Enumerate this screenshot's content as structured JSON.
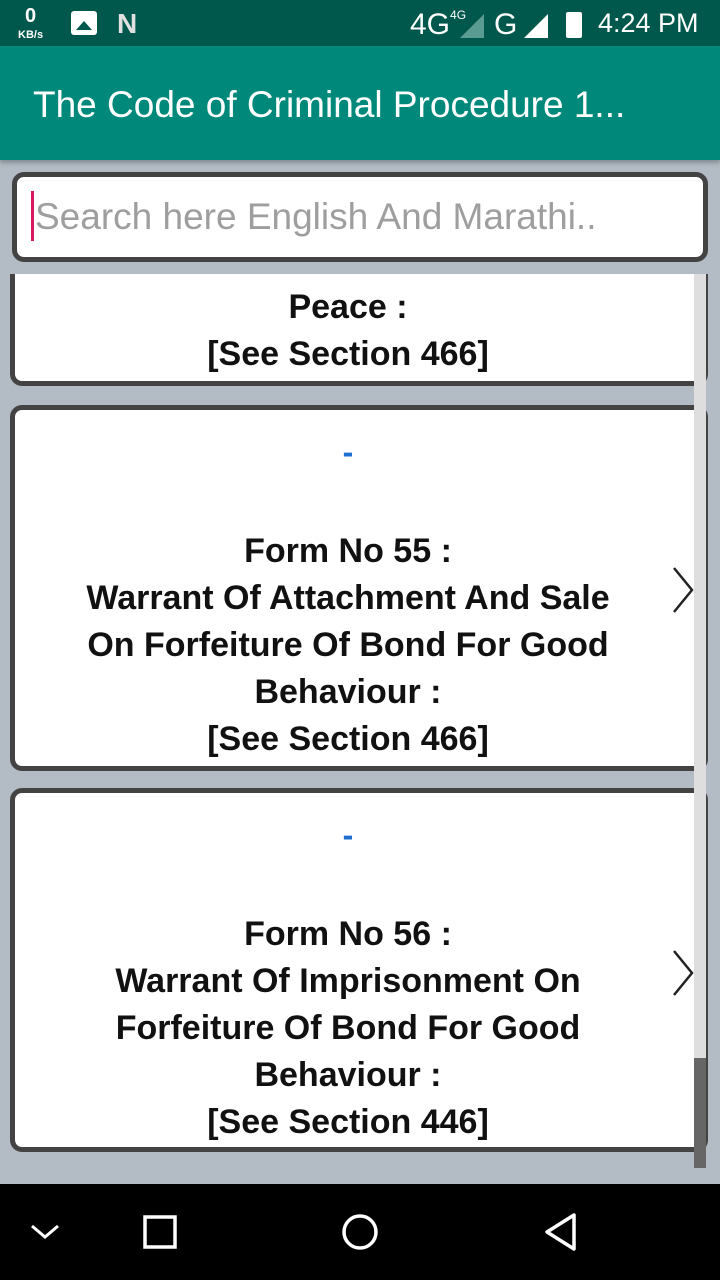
{
  "status_bar": {
    "net_speed": "0",
    "net_unit": "KB/s",
    "network1": "4G",
    "network1_sup": "4G",
    "network2": "G",
    "time": "4:24 PM",
    "icons": [
      "image-icon",
      "n-icon",
      "signal-icon",
      "battery-charging-icon"
    ]
  },
  "app_bar": {
    "title": "The Code of Criminal Procedure 1..."
  },
  "search": {
    "placeholder": "Search here English And Marathi..",
    "value": ""
  },
  "list": {
    "items": [
      {
        "dash": "",
        "lines": [
          "Peace :",
          "[See Section 466]"
        ]
      },
      {
        "dash": "-",
        "lines": [
          "Form No 55 :",
          "Warrant Of Attachment And Sale",
          "On Forfeiture Of Bond For Good",
          "Behaviour :",
          "[See Section 466]"
        ]
      },
      {
        "dash": "-",
        "lines": [
          "Form No 56 :",
          "Warrant Of Imprisonment On",
          "Forfeiture Of Bond For Good",
          "Behaviour :",
          "[See Section 446]"
        ]
      }
    ]
  },
  "colors": {
    "status_bar": "#00574b",
    "app_bar": "#00897b",
    "dash": "#1e6fd0",
    "background": "#b3bbc4"
  },
  "nav": {
    "icons": [
      "collapse-icon",
      "recents-icon",
      "home-icon",
      "back-icon"
    ]
  }
}
